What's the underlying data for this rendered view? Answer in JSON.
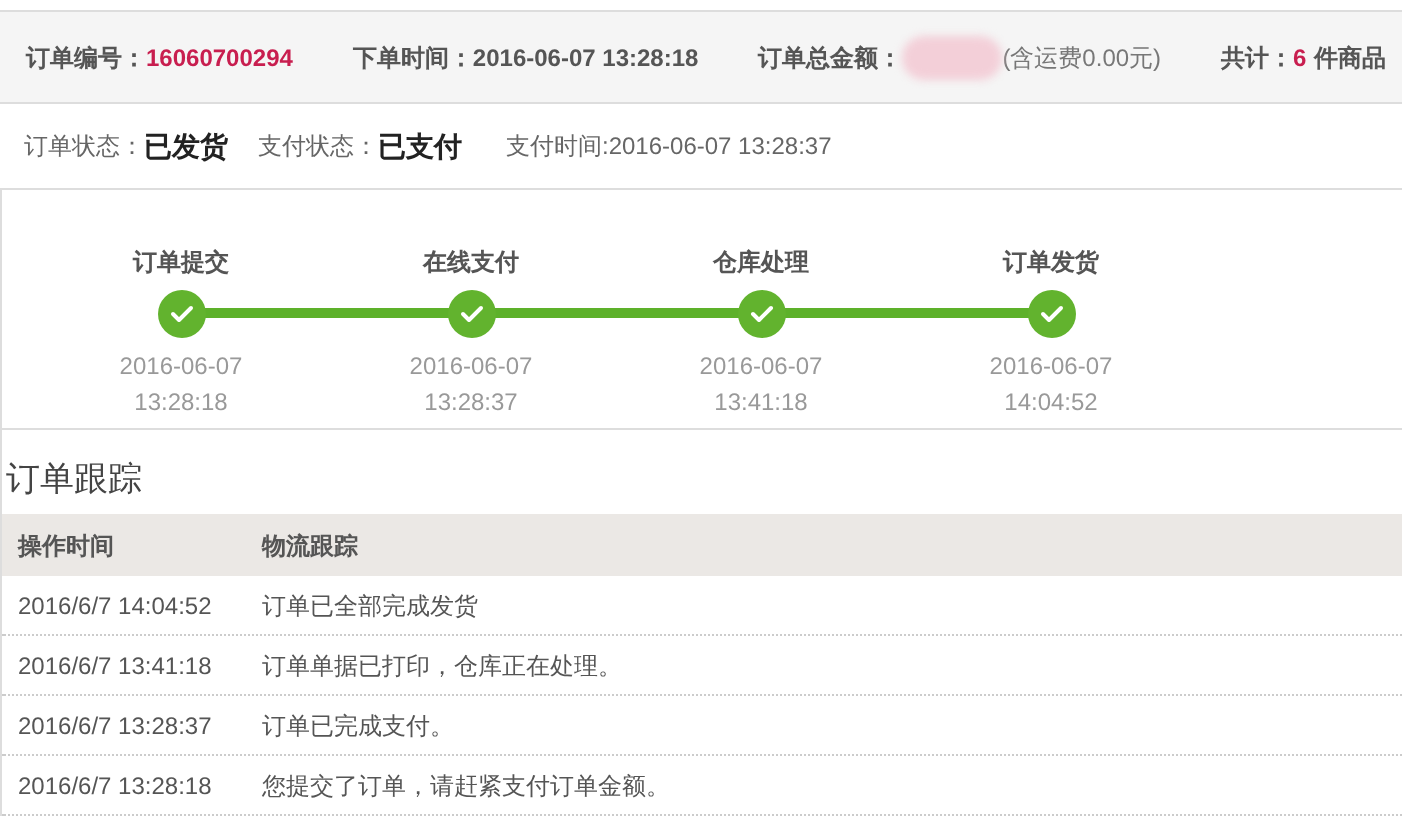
{
  "summary": [
    {
      "label": "订单编号：",
      "value": "16060700294",
      "kind": "accent"
    },
    {
      "label": "下单时间：",
      "value": "2016-06-07 13:28:18",
      "kind": "plain"
    },
    {
      "label": "订单总金额：",
      "kind": "hidden",
      "note": "(含运费0.00元)"
    },
    {
      "label": "共计：",
      "value": "6",
      "kind": "count",
      "suffix": "件商品"
    }
  ],
  "status": {
    "order_label": "订单状态：",
    "order_value": "已发货",
    "pay_label": "支付状态：",
    "pay_value": "已支付",
    "pay_time": "支付时间:2016-06-07 13:28:37"
  },
  "steps": [
    {
      "label": "订单提交",
      "date": "2016-06-07",
      "time": "13:28:18",
      "done": true
    },
    {
      "label": "在线支付",
      "date": "2016-06-07",
      "time": "13:28:37",
      "done": true
    },
    {
      "label": "仓库处理",
      "date": "2016-06-07",
      "time": "13:41:18",
      "done": true
    },
    {
      "label": "订单发货",
      "date": "2016-06-07",
      "time": "14:04:52",
      "done": true
    }
  ],
  "tracking": {
    "title": "订单跟踪",
    "columns": [
      "操作时间",
      "物流跟踪"
    ],
    "rows": [
      [
        "2016/6/7 14:04:52",
        "订单已全部完成发货"
      ],
      [
        "2016/6/7 13:41:18",
        "订单单据已打印，仓库正在处理。"
      ],
      [
        "2016/6/7 13:28:37",
        "订单已完成支付。"
      ],
      [
        "2016/6/7 13:28:18",
        "您提交了订单，请赶紧支付订单金额。"
      ]
    ]
  }
}
